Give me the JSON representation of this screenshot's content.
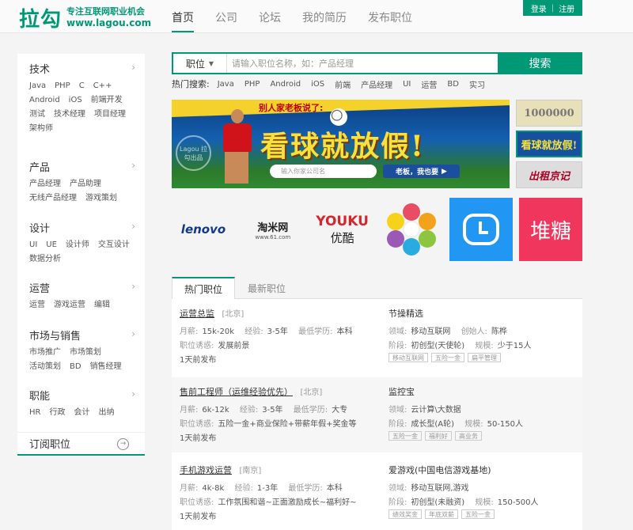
{
  "header": {
    "logo_mark": "拉勾",
    "logo_slogan": "专注互联网职业机会",
    "logo_url": "www.lagou.com",
    "nav": [
      "首页",
      "公司",
      "论坛",
      "我的简历",
      "发布职位"
    ],
    "login": "登录",
    "separator": "|",
    "register": "注册"
  },
  "sidebar": {
    "categories": [
      {
        "title": "技术",
        "tags": [
          "Java",
          "PHP",
          "C",
          "C++",
          "Android",
          "iOS",
          "前端开发",
          "测试",
          "技术经理",
          "项目经理",
          "架构师"
        ]
      },
      {
        "title": "产品",
        "tags": [
          "产品经理",
          "产品助理",
          "无线产品经理",
          "游戏策划"
        ]
      },
      {
        "title": "设计",
        "tags": [
          "UI",
          "UE",
          "设计师",
          "交互设计",
          "数据分析"
        ]
      },
      {
        "title": "运营",
        "tags": [
          "运营",
          "游戏运营",
          "编辑"
        ]
      },
      {
        "title": "市场与销售",
        "tags": [
          "市场推广",
          "市场策划",
          "活动策划",
          "BD",
          "销售经理"
        ]
      },
      {
        "title": "职能",
        "tags": [
          "HR",
          "行政",
          "会计",
          "出纳"
        ]
      }
    ],
    "arrow": "›",
    "subscribe": "订阅职位",
    "subscribe_icon": "→"
  },
  "search": {
    "type": "职位",
    "placeholder": "请输入职位名称，如：产品经理",
    "button": "搜索",
    "hot_label": "热门搜索:",
    "hot": [
      "Java",
      "PHP",
      "Android",
      "iOS",
      "前端",
      "产品经理",
      "UI",
      "运营",
      "BD",
      "实习"
    ]
  },
  "banner": {
    "kicker": "别人家老板说了:",
    "headline": "看球就放假!",
    "stamp": "Lagou 拉勾出品",
    "input_placeholder": "输入你家公司名",
    "cta": "老板，我也要",
    "cta_icon": "▶",
    "thumbs": [
      "1000000",
      "看球就放假!",
      "出租京记"
    ]
  },
  "logos": {
    "lenovo": "lenovo",
    "taomi": "淘米网",
    "taomi_sub": "www.61.com",
    "youku": "YOUKU",
    "youku_cn": "优酷",
    "duitang": "堆糖"
  },
  "tabs": [
    "热门职位",
    "最新职位"
  ],
  "jobs": [
    {
      "title": "运营总监",
      "city": "[北京]",
      "salary_k": "月薪:",
      "salary": "15k-20k",
      "exp_k": "经验:",
      "exp": "3-5年",
      "edu_k": "最低学历:",
      "edu": "本科",
      "perk_k": "职位诱惑:",
      "perk": "发展前景",
      "time": "1天前发布",
      "company": "节操精选",
      "field_k": "领域:",
      "field": "移动互联网",
      "founder_k": "创始人:",
      "founder": "陈桦",
      "stage_k": "阶段:",
      "stage": "初创型(天使轮)",
      "size_k": "规模:",
      "size": "少于15人",
      "tags": [
        "移动互联网",
        "五险一金",
        "扁平管理"
      ]
    },
    {
      "title": "售前工程师（运维经验优先）",
      "city": "[北京]",
      "salary_k": "月薪:",
      "salary": "6k-12k",
      "exp_k": "经验:",
      "exp": "3-5年",
      "edu_k": "最低学历:",
      "edu": "大专",
      "perk_k": "职位诱惑:",
      "perk": "五险一金+商业保险+带薪年假+奖金等",
      "time": "1天前发布",
      "company": "监控宝",
      "field_k": "领域:",
      "field": "云计算\\大数据",
      "founder_k": "",
      "founder": "",
      "stage_k": "阶段:",
      "stage": "成长型(A轮)",
      "size_k": "规模:",
      "size": "50-150人",
      "tags": [
        "五险一金",
        "福利好",
        "高业务"
      ]
    },
    {
      "title": "手机游戏运营",
      "city": "[南京]",
      "salary_k": "月薪:",
      "salary": "4k-8k",
      "exp_k": "经验:",
      "exp": "1-3年",
      "edu_k": "最低学历:",
      "edu": "本科",
      "perk_k": "职位诱惑:",
      "perk": "工作氛围和谐~正面激励成长~福利好~",
      "time": "1天前发布",
      "company": "爱游戏(中国电信游戏基地)",
      "field_k": "领域:",
      "field": "移动互联网,游戏",
      "founder_k": "",
      "founder": "",
      "stage_k": "阶段:",
      "stage": "初创型(未融资)",
      "size_k": "规模:",
      "size": "150-500人",
      "tags": [
        "绩效奖金",
        "年底双薪",
        "五险一金"
      ]
    }
  ],
  "colors": {
    "brand": "#019875",
    "banner_yellow": "#f6e23b",
    "duitang": "#f0365c",
    "clock": "#2196f3"
  }
}
